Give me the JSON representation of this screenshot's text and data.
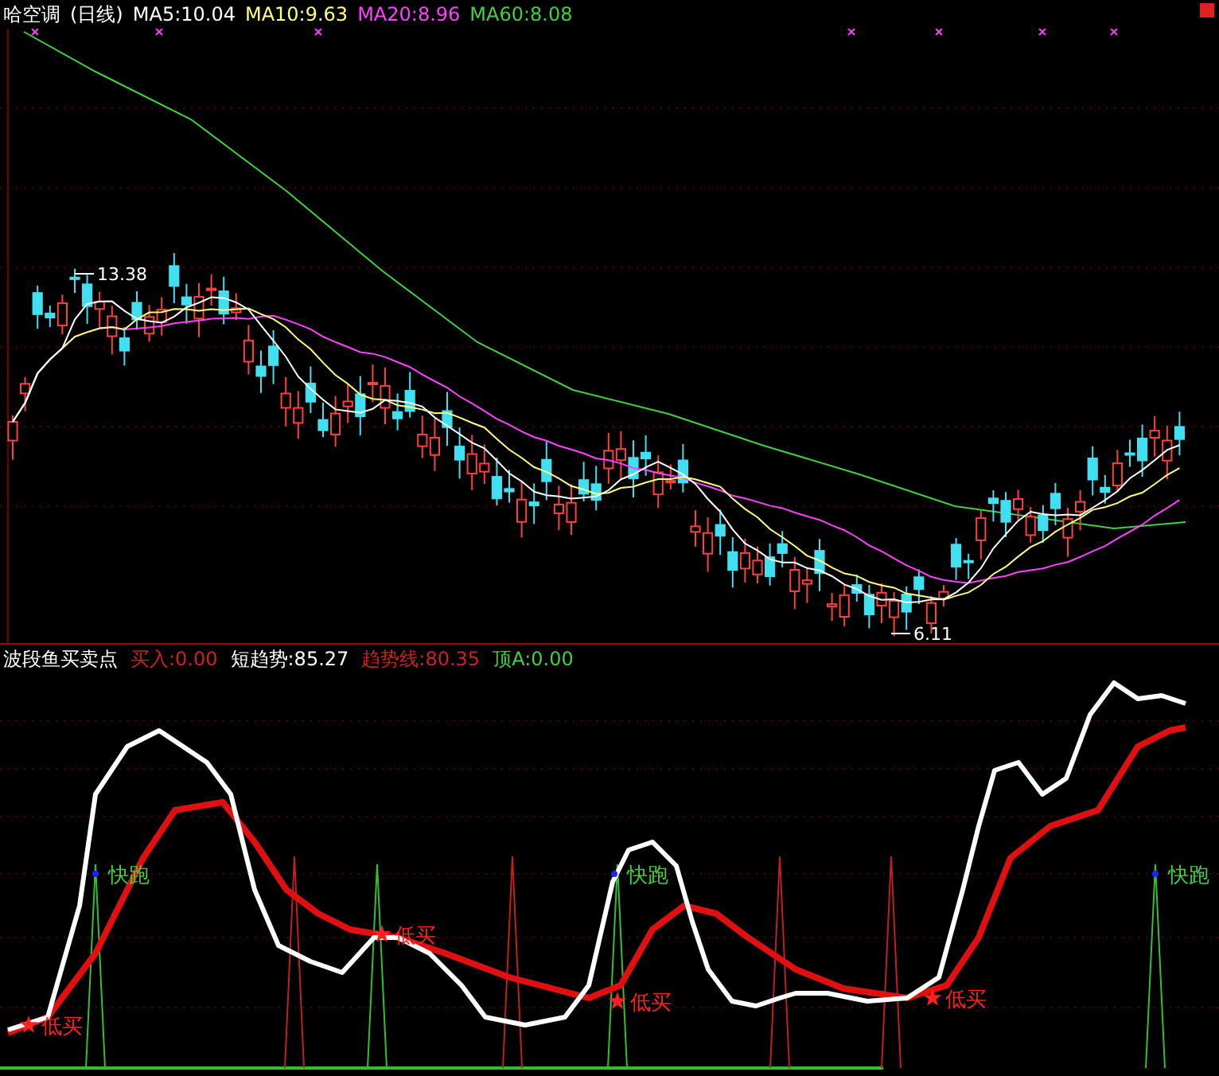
{
  "main_panel": {
    "title": "哈空调",
    "period": "(日线)",
    "indicators": [
      {
        "label": "MA5:10.04",
        "color": "#ffffff"
      },
      {
        "label": "MA10:9.63",
        "color": "#ffff80"
      },
      {
        "label": "MA20:8.96",
        "color": "#ff40ff"
      },
      {
        "label": "MA60:8.08",
        "color": "#40d040"
      }
    ],
    "price_labels": [
      {
        "kind": "high",
        "text": "13.38"
      },
      {
        "kind": "low",
        "text": "6.11"
      }
    ]
  },
  "indicator_panel": {
    "title": "波段鱼买卖点",
    "indicators": [
      {
        "label": "买入:0.00",
        "color": "#d02020"
      },
      {
        "label": "短趋势:85.27",
        "color": "#ffffff"
      },
      {
        "label": "趋势线:80.35",
        "color": "#d02020"
      },
      {
        "label": "顶A:0.00",
        "color": "#40d040"
      }
    ],
    "signals": [
      {
        "kind": "buy",
        "label": "低买"
      },
      {
        "kind": "run",
        "label": "快跑"
      },
      {
        "kind": "buy",
        "label": "低买"
      },
      {
        "kind": "run",
        "label": "快跑"
      },
      {
        "kind": "buy",
        "label": "低买"
      },
      {
        "kind": "buy",
        "label": "低买"
      },
      {
        "kind": "run",
        "label": "快跑"
      }
    ]
  }
}
